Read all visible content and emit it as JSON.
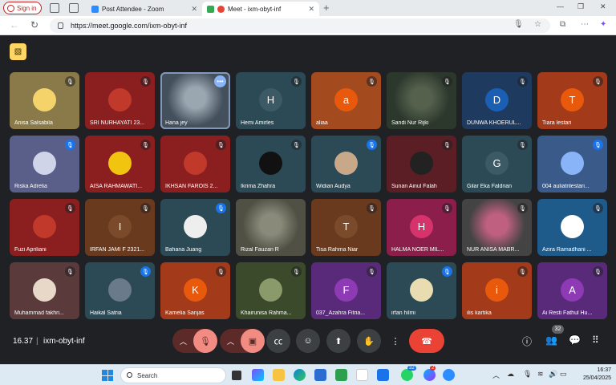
{
  "browser": {
    "signin_label": "Sign in",
    "tabs": [
      {
        "title": "Post Attendee - Zoom",
        "color": "#2d8cff"
      },
      {
        "title": "Meet - ixm-obyt-inf",
        "color": "#ea4335"
      }
    ],
    "url": "https://meet.google.com/ixm-obyt-inf"
  },
  "meet": {
    "time": "16.37",
    "separator": "|",
    "code": "ixm-obyt-inf",
    "people_count": "32",
    "participants": [
      {
        "name": "Anisa Salsabila",
        "bg": "#8a7a4a",
        "avatar": "photo",
        "avatar_bg": "#f3d36a",
        "mic": "muted"
      },
      {
        "name": "SRI NURHAYATI 23...",
        "bg": "#8b1e1e",
        "avatar": "photo",
        "avatar_bg": "#c0392b",
        "mic": "muted"
      },
      {
        "name": "Hana jey",
        "bg": "#5a6a7a",
        "avatar": "video",
        "avatar_bg": "#9aa7b0",
        "mic": "more"
      },
      {
        "name": "Hemi Amirles",
        "bg": "#2c4a55",
        "avatar": "letter",
        "letter": "H",
        "avatar_bg": "#3c5a66",
        "mic": "muted"
      },
      {
        "name": "aliaa",
        "bg": "#a34a1f",
        "avatar": "letter",
        "letter": "a",
        "avatar_bg": "#e8590c",
        "mic": "muted"
      },
      {
        "name": "Sandi Nur Rijki",
        "bg": "#3a4a3a",
        "avatar": "video",
        "avatar_bg": "#55614d",
        "mic": "muted"
      },
      {
        "name": "DUNWA KHOERUL...",
        "bg": "#1e3a5f",
        "avatar": "letter",
        "letter": "D",
        "avatar_bg": "#1a5fb4",
        "mic": "muted"
      },
      {
        "name": "Tiara lestari",
        "bg": "#a33a1a",
        "avatar": "letter",
        "letter": "T",
        "avatar_bg": "#e8590c",
        "mic": "muted"
      },
      {
        "name": "Riska Adrelia",
        "bg": "#5a5f8a",
        "avatar": "photo",
        "avatar_bg": "#cfd4e8",
        "mic": "blue"
      },
      {
        "name": "AISA RAHMAWATI...",
        "bg": "#8b1e1e",
        "avatar": "photo",
        "avatar_bg": "#f1c40f",
        "mic": "muted"
      },
      {
        "name": "IKHSAN FAROIS 2...",
        "bg": "#8b1e1e",
        "avatar": "photo",
        "avatar_bg": "#c0392b",
        "mic": "muted"
      },
      {
        "name": "Ikrima Zhahra",
        "bg": "#2c4a55",
        "avatar": "photo",
        "avatar_bg": "#111111",
        "mic": "muted"
      },
      {
        "name": "Widian Audya",
        "bg": "#2c4a55",
        "avatar": "photo",
        "avatar_bg": "#c9a88a",
        "mic": "blue"
      },
      {
        "name": "Sunan Ainul Falah",
        "bg": "#5a1e24",
        "avatar": "photo",
        "avatar_bg": "#222222",
        "mic": "muted"
      },
      {
        "name": "Gilar Eka Faldrian",
        "bg": "#2c4a55",
        "avatar": "letter",
        "letter": "G",
        "avatar_bg": "#3c5a66",
        "mic": "muted"
      },
      {
        "name": "004 auliatrilestari...",
        "bg": "#3a5a8a",
        "avatar": "letter",
        "letter": "",
        "avatar_bg": "#8ab4f8",
        "mic": "blue"
      },
      {
        "name": "Fuzi Apriliani",
        "bg": "#8b1e1e",
        "avatar": "photo",
        "avatar_bg": "#c0392b",
        "mic": "muted"
      },
      {
        "name": "IRFAN JAMI F 2321...",
        "bg": "#6a3a1f",
        "avatar": "letter",
        "letter": "I",
        "avatar_bg": "#7a4a2a",
        "mic": "muted"
      },
      {
        "name": "Bahana Juang",
        "bg": "#2c4a55",
        "avatar": "photo",
        "avatar_bg": "#eeeeee",
        "mic": "blue"
      },
      {
        "name": "Rizal Fauzan R",
        "bg": "#6a6a5a",
        "avatar": "video",
        "avatar_bg": "#8a8a7a",
        "mic": "none"
      },
      {
        "name": "Tisa Rahma Niar",
        "bg": "#6a3a1f",
        "avatar": "letter",
        "letter": "T",
        "avatar_bg": "#7a4a2a",
        "mic": "muted"
      },
      {
        "name": "HALMA NOER MIL...",
        "bg": "#8b1e4a",
        "avatar": "letter",
        "letter": "H",
        "avatar_bg": "#d6336c",
        "mic": "muted"
      },
      {
        "name": "NUR ANISA MABR...",
        "bg": "#5a5a5a",
        "avatar": "video",
        "avatar_bg": "#c06080",
        "mic": "muted"
      },
      {
        "name": "Azira Ramadhani ...",
        "bg": "#1e5a8a",
        "avatar": "photo",
        "avatar_bg": "#ffffff",
        "mic": "muted"
      },
      {
        "name": "Muhammad fakhri...",
        "bg": "#5a3a3a",
        "avatar": "photo",
        "avatar_bg": "#e8d8c8",
        "mic": "muted"
      },
      {
        "name": "Haikal Satria",
        "bg": "#2c4a55",
        "avatar": "photo",
        "avatar_bg": "#6a7a8a",
        "mic": "blue"
      },
      {
        "name": "Kamelia Sanjas",
        "bg": "#a33a1a",
        "avatar": "letter",
        "letter": "K",
        "avatar_bg": "#e8590c",
        "mic": "muted"
      },
      {
        "name": "Khairunisa Rahma...",
        "bg": "#3a4a2a",
        "avatar": "photo",
        "avatar_bg": "#8a9a6a",
        "mic": "muted"
      },
      {
        "name": "037_Azahra Fitria...",
        "bg": "#5a2a7a",
        "avatar": "letter",
        "letter": "F",
        "avatar_bg": "#8e3ab5",
        "mic": "muted"
      },
      {
        "name": "irfan hilmi",
        "bg": "#2c4a55",
        "avatar": "photo",
        "avatar_bg": "#e8dcb0",
        "mic": "blue"
      },
      {
        "name": "ilis kartika",
        "bg": "#a33a1a",
        "avatar": "letter",
        "letter": "i",
        "avatar_bg": "#e8590c",
        "mic": "muted"
      },
      {
        "name": "Ai Resti Fathul Hu...",
        "bg": "#5a2a7a",
        "avatar": "letter",
        "letter": "A",
        "avatar_bg": "#8e3ab5",
        "mic": "muted"
      }
    ]
  },
  "taskbar": {
    "search_label": "Search",
    "badge_whatsapp": "32",
    "badge_messenger": "2",
    "time": "16:37",
    "date": "25/04/2025"
  }
}
